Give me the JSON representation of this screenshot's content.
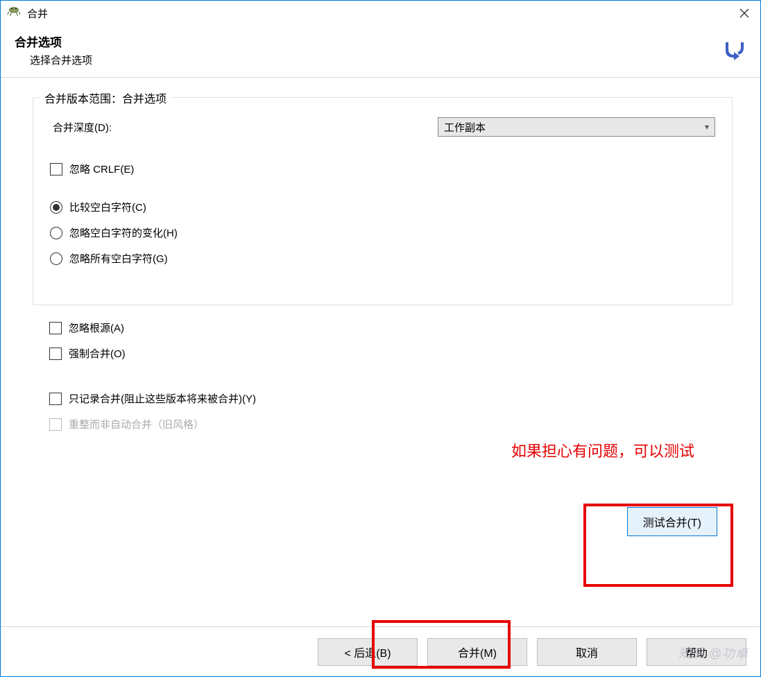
{
  "window": {
    "title": "合并"
  },
  "header": {
    "title": "合并选项",
    "subtitle": "选择合并选项"
  },
  "group": {
    "legend": "合并版本范围：合并选项",
    "depth_label": "合并深度(D):",
    "depth_value": "工作副本",
    "ignore_crlf": "忽略 CRLF(E)",
    "radios": {
      "compare": "比较空白字符(C)",
      "ignore_changes": "忽略空白字符的变化(H)",
      "ignore_all": "忽略所有空白字符(G)"
    }
  },
  "checks": {
    "ignore_ancestry": "忽略根源(A)",
    "force_merge": "强制合并(O)",
    "record_only": "只记录合并(阻止这些版本将来被合并)(Y)",
    "reintegrate": "重整而非自动合并（旧风格）"
  },
  "buttons": {
    "test_merge": "测试合并(T)",
    "back": "<  后退(B)",
    "merge": "合并(M)",
    "cancel": "取消",
    "help": "帮助"
  },
  "annotation": "如果担心有问题，可以测试",
  "watermark": "知乎 @功卓"
}
